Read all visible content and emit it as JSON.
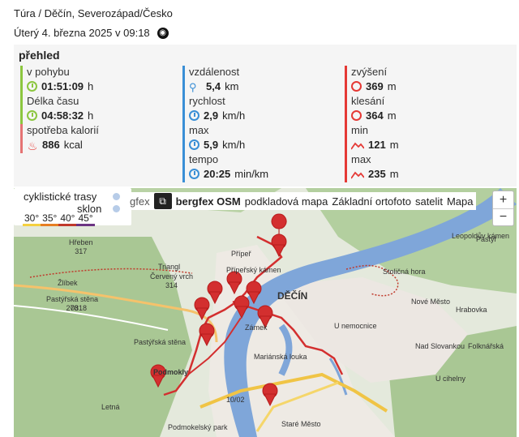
{
  "header": {
    "route": "Túra / Děčín, Severozápad/Česko",
    "datetime": "Úterý 4. března 2025 v 09:18",
    "globe_icon": "globe-icon"
  },
  "overview": {
    "title": "přehled",
    "columns": [
      [
        {
          "label": "v pohybu",
          "value": "01:51:09",
          "unit": "h",
          "icon": "clock-icon",
          "color": "#8cc63f"
        },
        {
          "label": "Délka času",
          "value": "04:58:32",
          "unit": "h",
          "icon": "clock-icon",
          "color": "#8cc63f"
        },
        {
          "label": "spotřeba kalorií",
          "value": "886",
          "unit": "kcal",
          "icon": "fire-icon",
          "color": "#e57373"
        }
      ],
      [
        {
          "label": "vzdálenost",
          "value": "5,4",
          "unit": "km",
          "icon": "distance-icon",
          "color": "#3a8fd6"
        },
        {
          "label": "rychlost",
          "value": "2,9",
          "unit": "km/h",
          "icon": "speed-icon",
          "color": "#3a8fd6"
        },
        {
          "label": "max",
          "value": "5,9",
          "unit": "km/h",
          "icon": "speed-icon",
          "color": "#3a8fd6"
        },
        {
          "label": "tempo",
          "value": "20:25",
          "unit": "min/km",
          "icon": "pace-icon",
          "color": "#3a8fd6"
        }
      ],
      [
        {
          "label": "zvýšení",
          "value": "369",
          "unit": "m",
          "icon": "ascent-icon",
          "color": "#e53935"
        },
        {
          "label": "klesání",
          "value": "364",
          "unit": "m",
          "icon": "descent-icon",
          "color": "#e53935"
        },
        {
          "label": "min",
          "value": "121",
          "unit": "m",
          "icon": "altitude-icon",
          "color": "#e53935"
        },
        {
          "label": "max",
          "value": "235",
          "unit": "m",
          "icon": "altitude-icon",
          "color": "#e53935"
        }
      ]
    ]
  },
  "map": {
    "legend": {
      "cycle": "cyklistické trasy",
      "slope": "sklon"
    },
    "slope_scale": [
      "30°",
      "35°",
      "40°",
      "45°"
    ],
    "slope_colors": [
      "#f4d03f",
      "#e67e22",
      "#c0392b",
      "#6c3483"
    ],
    "layers": [
      "bergfex OSM",
      "bergfex OSM",
      "podkladová mapa",
      "Základní ortofoto",
      "satelit",
      "Mapa"
    ],
    "layers_prefix": "gfex",
    "zoom_in": "+",
    "zoom_out": "−",
    "labels": [
      {
        "text": "Hřeben",
        "sub": "317"
      },
      {
        "text": "Žlíbek"
      },
      {
        "text": "Triangl"
      },
      {
        "text": "Červený vrch",
        "sub": "314"
      },
      {
        "text": "Pastýřská stěna",
        "sub": "278"
      },
      {
        "text": "Přípeř"
      },
      {
        "text": "Přípeřský kámen"
      },
      {
        "text": "DĚČÍN"
      },
      {
        "text": "Zámek"
      },
      {
        "text": "Mariánská louka"
      },
      {
        "text": "Podmokly"
      },
      {
        "text": "Letná"
      },
      {
        "text": "Staré Město"
      },
      {
        "text": "Nové Město"
      },
      {
        "text": "Nad Slovankou"
      },
      {
        "text": "U cihelny"
      },
      {
        "text": "Leopoldův kámen"
      },
      {
        "text": "Stoličná hora"
      },
      {
        "text": "U nemocnice"
      },
      {
        "text": "Folknářská"
      },
      {
        "text": "Hrabovka"
      },
      {
        "text": "Pastýřská stěna"
      },
      {
        "text": "Pastýř"
      },
      {
        "text": "0318"
      },
      {
        "text": "10/02"
      },
      {
        "text": "Podmokelský park"
      }
    ]
  }
}
